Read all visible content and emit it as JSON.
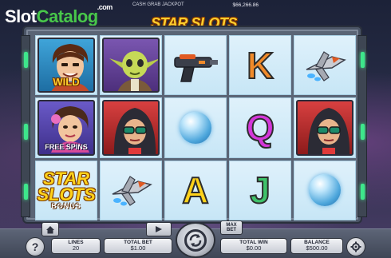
{
  "watermark": {
    "slot": "Slot",
    "catalog": "Catalog",
    "com": ".com"
  },
  "jackpot": {
    "label": "CASH GRAB JACKPOT",
    "value": "$66,266.86"
  },
  "game": {
    "title": "STAR SLOTS"
  },
  "symbols": {
    "wild_label": "WILD",
    "free_spins_label": "FREE SPINS",
    "bonus_line1": "STAR",
    "bonus_line2": "SLOTS",
    "bonus_line3": "BONUS",
    "letter_K": "K",
    "letter_Q": "Q",
    "letter_A": "A",
    "letter_J": "J"
  },
  "reels": [
    [
      "wild-character",
      "free-spins-character",
      "star-slots-bonus"
    ],
    [
      "alien-character",
      "hooded-character",
      "spaceship"
    ],
    [
      "blaster",
      "ice-orb",
      "A"
    ],
    [
      "K",
      "Q",
      "J"
    ],
    [
      "spaceship",
      "hooded-character",
      "ice-orb"
    ]
  ],
  "controls": {
    "help": "?",
    "lines_label": "LINES",
    "lines_value": "20",
    "total_bet_label": "TOTAL BET",
    "total_bet_value": "$1.00",
    "total_win_label": "TOTAL WIN",
    "total_win_value": "$0.00",
    "balance_label": "BALANCE",
    "balance_value": "$500.00",
    "max_bet_line1": "MAX",
    "max_bet_line2": "BET"
  },
  "colors": {
    "frame_light": "#3ee68b",
    "title": "#ffcf2e",
    "catalog_green": "#48c74a"
  }
}
